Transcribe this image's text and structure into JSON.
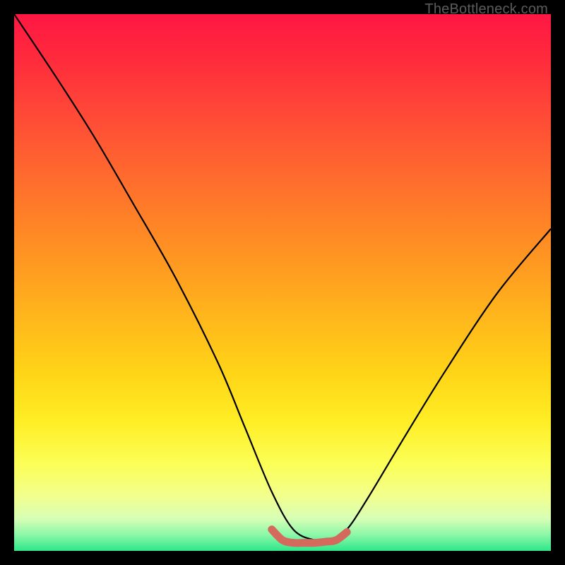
{
  "watermark": "TheBottleneck.com",
  "chart_data": {
    "type": "line",
    "title": "",
    "xlabel": "",
    "ylabel": "",
    "xlim": [
      0,
      100
    ],
    "ylim": [
      0,
      100
    ],
    "series": [
      {
        "name": "bottleneck-curve",
        "color": "#000000",
        "x": [
          0,
          8,
          15,
          22,
          30,
          38,
          43,
          48,
          52,
          56,
          59,
          62,
          66,
          72,
          80,
          90,
          100
        ],
        "values": [
          100,
          88,
          77,
          65,
          51,
          35,
          23,
          11,
          4,
          2,
          2,
          4,
          10,
          20,
          33,
          48,
          60
        ]
      },
      {
        "name": "optimal-band",
        "color": "#d46a5e",
        "x": [
          48,
          50,
          52,
          54,
          56,
          58,
          60,
          62
        ],
        "values": [
          4,
          2,
          1.5,
          1.5,
          1.5,
          1.7,
          2,
          3.5
        ]
      }
    ]
  },
  "colors": {
    "background": "#000000",
    "curve": "#000000",
    "band": "#d46a5e",
    "watermark": "#5c5c5c"
  }
}
